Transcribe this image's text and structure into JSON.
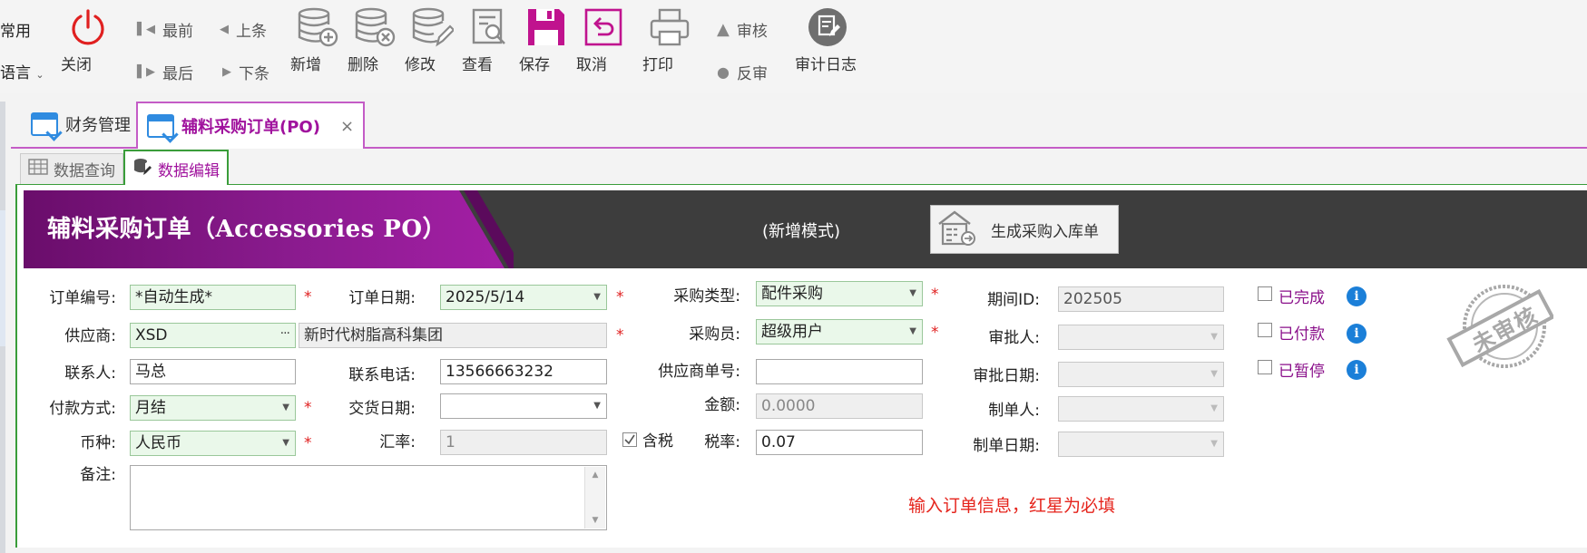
{
  "toolbar": {
    "left_top": "常用",
    "left_bottom": "语言",
    "close": "关闭",
    "first": "最前",
    "prev": "上条",
    "last": "最后",
    "next": "下条",
    "add": "新增",
    "delete": "删除",
    "edit": "修改",
    "view": "查看",
    "save": "保存",
    "cancel": "取消",
    "print": "打印",
    "approve": "审核",
    "unapprove": "反审",
    "audit_log": "审计日志",
    "colors": {
      "close_red": "#e02020",
      "save_magenta": "#c0138e",
      "icon_gray": "#8a8a8a"
    }
  },
  "tabs": [
    {
      "label": "财务管理",
      "active": false
    },
    {
      "label": "辅料采购订单(PO)",
      "active": true,
      "close": "×"
    }
  ],
  "subtabs": [
    {
      "label": "数据查询",
      "active": false
    },
    {
      "label": "数据编辑",
      "active": true
    }
  ],
  "banner": {
    "title": "辅料采购订单（Accessories PO）",
    "mode": "(新增模式)",
    "generate_button": "生成采购入库单",
    "colors": {
      "purple": "#8a1b8e",
      "dark": "#3d3d3d"
    }
  },
  "form": {
    "order_no": {
      "label": "订单编号:",
      "value": "*自动生成*"
    },
    "order_date": {
      "label": "订单日期:",
      "value": "2025/5/14"
    },
    "purchase_type": {
      "label": "采购类型:",
      "value": "配件采购"
    },
    "period_id": {
      "label": "期间ID:",
      "value": "202505"
    },
    "supplier": {
      "label": "供应商:",
      "code": "XSD",
      "name": "新时代树脂高科集团"
    },
    "buyer": {
      "label": "采购员:",
      "value": "超级用户"
    },
    "approver": {
      "label": "审批人:",
      "value": ""
    },
    "contact": {
      "label": "联系人:",
      "value": "马总"
    },
    "phone": {
      "label": "联系电话:",
      "value": "13566663232"
    },
    "supplier_no": {
      "label": "供应商单号:",
      "value": ""
    },
    "approve_date": {
      "label": "审批日期:",
      "value": ""
    },
    "payment": {
      "label": "付款方式:",
      "value": "月结"
    },
    "delivery_date": {
      "label": "交货日期:",
      "value": ""
    },
    "amount": {
      "label": "金额:",
      "value": "0.0000"
    },
    "creator": {
      "label": "制单人:",
      "value": ""
    },
    "currency": {
      "label": "币种:",
      "value": "人民币"
    },
    "exchange_rate": {
      "label": "汇率:",
      "value": "1"
    },
    "tax_included": {
      "label": "含税",
      "checked": true
    },
    "tax_rate": {
      "label": "税率:",
      "value": "0.07"
    },
    "create_date": {
      "label": "制单日期:",
      "value": ""
    },
    "notes": {
      "label": "备注:",
      "value": ""
    }
  },
  "status_checks": [
    {
      "label": "已完成",
      "checked": false
    },
    {
      "label": "已付款",
      "checked": false
    },
    {
      "label": "已暂停",
      "checked": false
    }
  ],
  "stamp": "未审核",
  "hint": "输入订单信息，红星为必填",
  "required_mark": "*",
  "info_icon": "i"
}
